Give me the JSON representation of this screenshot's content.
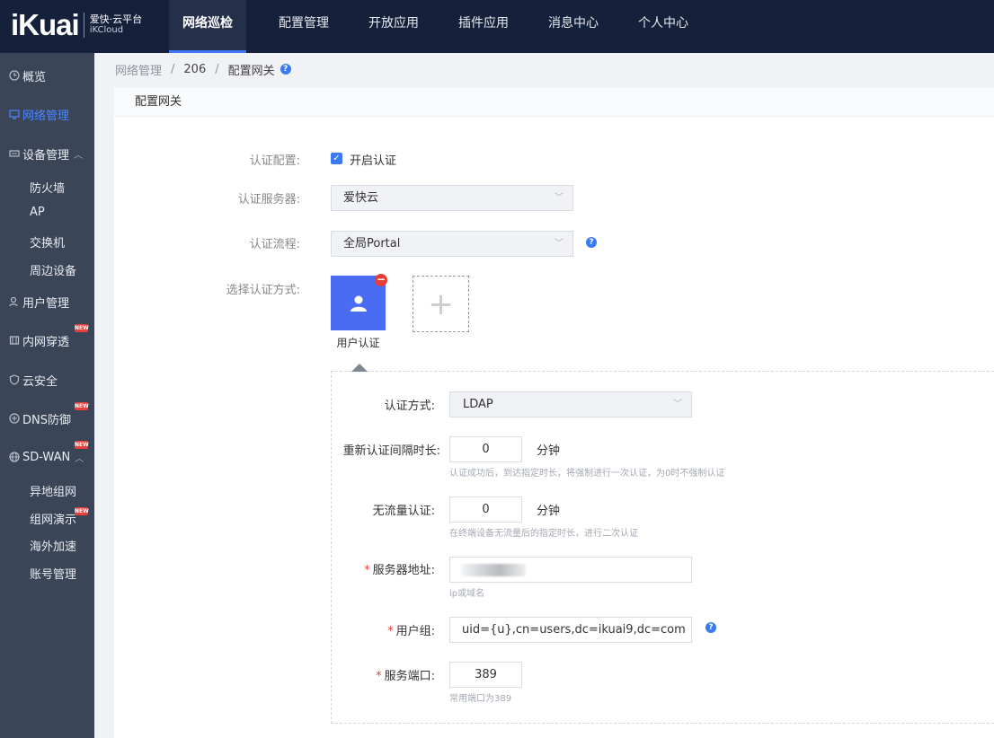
{
  "logo": {
    "main": "iKuai",
    "sub1": "爱快·云平台",
    "sub2": "iKCloud"
  },
  "nav": [
    "网络巡检",
    "配置管理",
    "开放应用",
    "插件应用",
    "消息中心",
    "个人中心"
  ],
  "sidebar": {
    "items": [
      {
        "label": "概览",
        "icon": "clock-icon"
      },
      {
        "label": "网络管理",
        "icon": "monitor-icon"
      },
      {
        "label": "设备管理",
        "icon": "device-icon"
      },
      {
        "label": "用户管理",
        "icon": "user-icon"
      },
      {
        "label": "内网穿透",
        "icon": "tunnel-icon"
      },
      {
        "label": "云安全",
        "icon": "shield-icon"
      },
      {
        "label": "DNS防御",
        "icon": "dns-icon"
      },
      {
        "label": "SD-WAN",
        "icon": "globe-icon"
      }
    ],
    "device_sub": [
      "防火墙",
      "AP",
      "交换机",
      "周边设备"
    ],
    "sdwan_sub": [
      "异地组网",
      "组网演示",
      "海外加速",
      "账号管理"
    ],
    "badge": "NEW"
  },
  "breadcrumb": {
    "root": "网络管理",
    "mid": "206",
    "current": "配置网关",
    "sep": "/"
  },
  "panel": {
    "title": "配置网关"
  },
  "form": {
    "auth_config_label": "认证配置:",
    "auth_enable_label": "开启认证",
    "auth_enabled": true,
    "auth_server_label": "认证服务器:",
    "auth_server_value": "爱快云",
    "auth_flow_label": "认证流程:",
    "auth_flow_value": "全局Portal",
    "auth_method_select_label": "选择认证方式:",
    "tile_label": "用户认证",
    "add_symbol": "+"
  },
  "sub": {
    "method_label": "认证方式:",
    "method_value": "LDAP",
    "reauth_label": "重新认证间隔时长:",
    "reauth_value": "0",
    "reauth_unit": "分钟",
    "reauth_hint": "认证成功后，到达指定时长，将强制进行一次认证，为0时不强制认证",
    "idle_label": "无流量认证:",
    "idle_value": "0",
    "idle_unit": "分钟",
    "idle_hint": "在终端设备无流量后的指定时长，进行二次认证",
    "server_label": "服务器地址:",
    "server_hint": "ip或域名",
    "group_label": "用户组:",
    "group_value": "uid={u},cn=users,dc=ikuai9,dc=com",
    "port_label": "服务端口:",
    "port_value": "389",
    "port_hint": "常用端口为389",
    "required_mark": "*"
  }
}
